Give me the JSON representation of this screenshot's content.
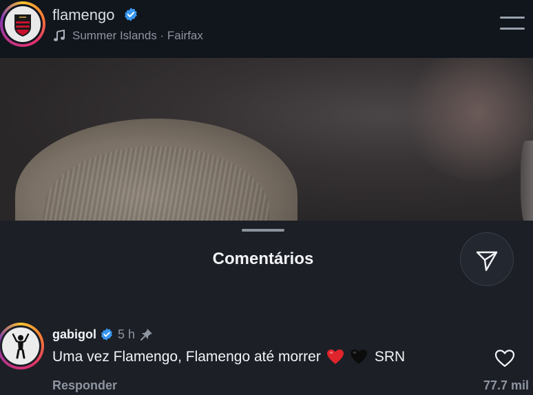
{
  "header": {
    "username": "flamengo",
    "music": "Summer Islands · Fairfax"
  },
  "sheet": {
    "title": "Comentários"
  },
  "comment": {
    "username": "gabigol",
    "time": "5 h",
    "text": "Uma vez Flamengo, Flamengo até morrer",
    "text_suffix": "SRN",
    "reply_label": "Responder",
    "likes": "77.7 mil"
  },
  "colors": {
    "background": "#1c1f26",
    "header": "#11151c",
    "verified": "#3897f0",
    "muted": "#8e95a0",
    "heart_red": "#e0242c"
  },
  "icons": [
    "music-note-icon",
    "verified-badge-icon",
    "menu-icon",
    "send-icon",
    "pin-icon",
    "red-heart-emoji-icon",
    "black-heart-emoji-icon",
    "like-heart-icon"
  ]
}
